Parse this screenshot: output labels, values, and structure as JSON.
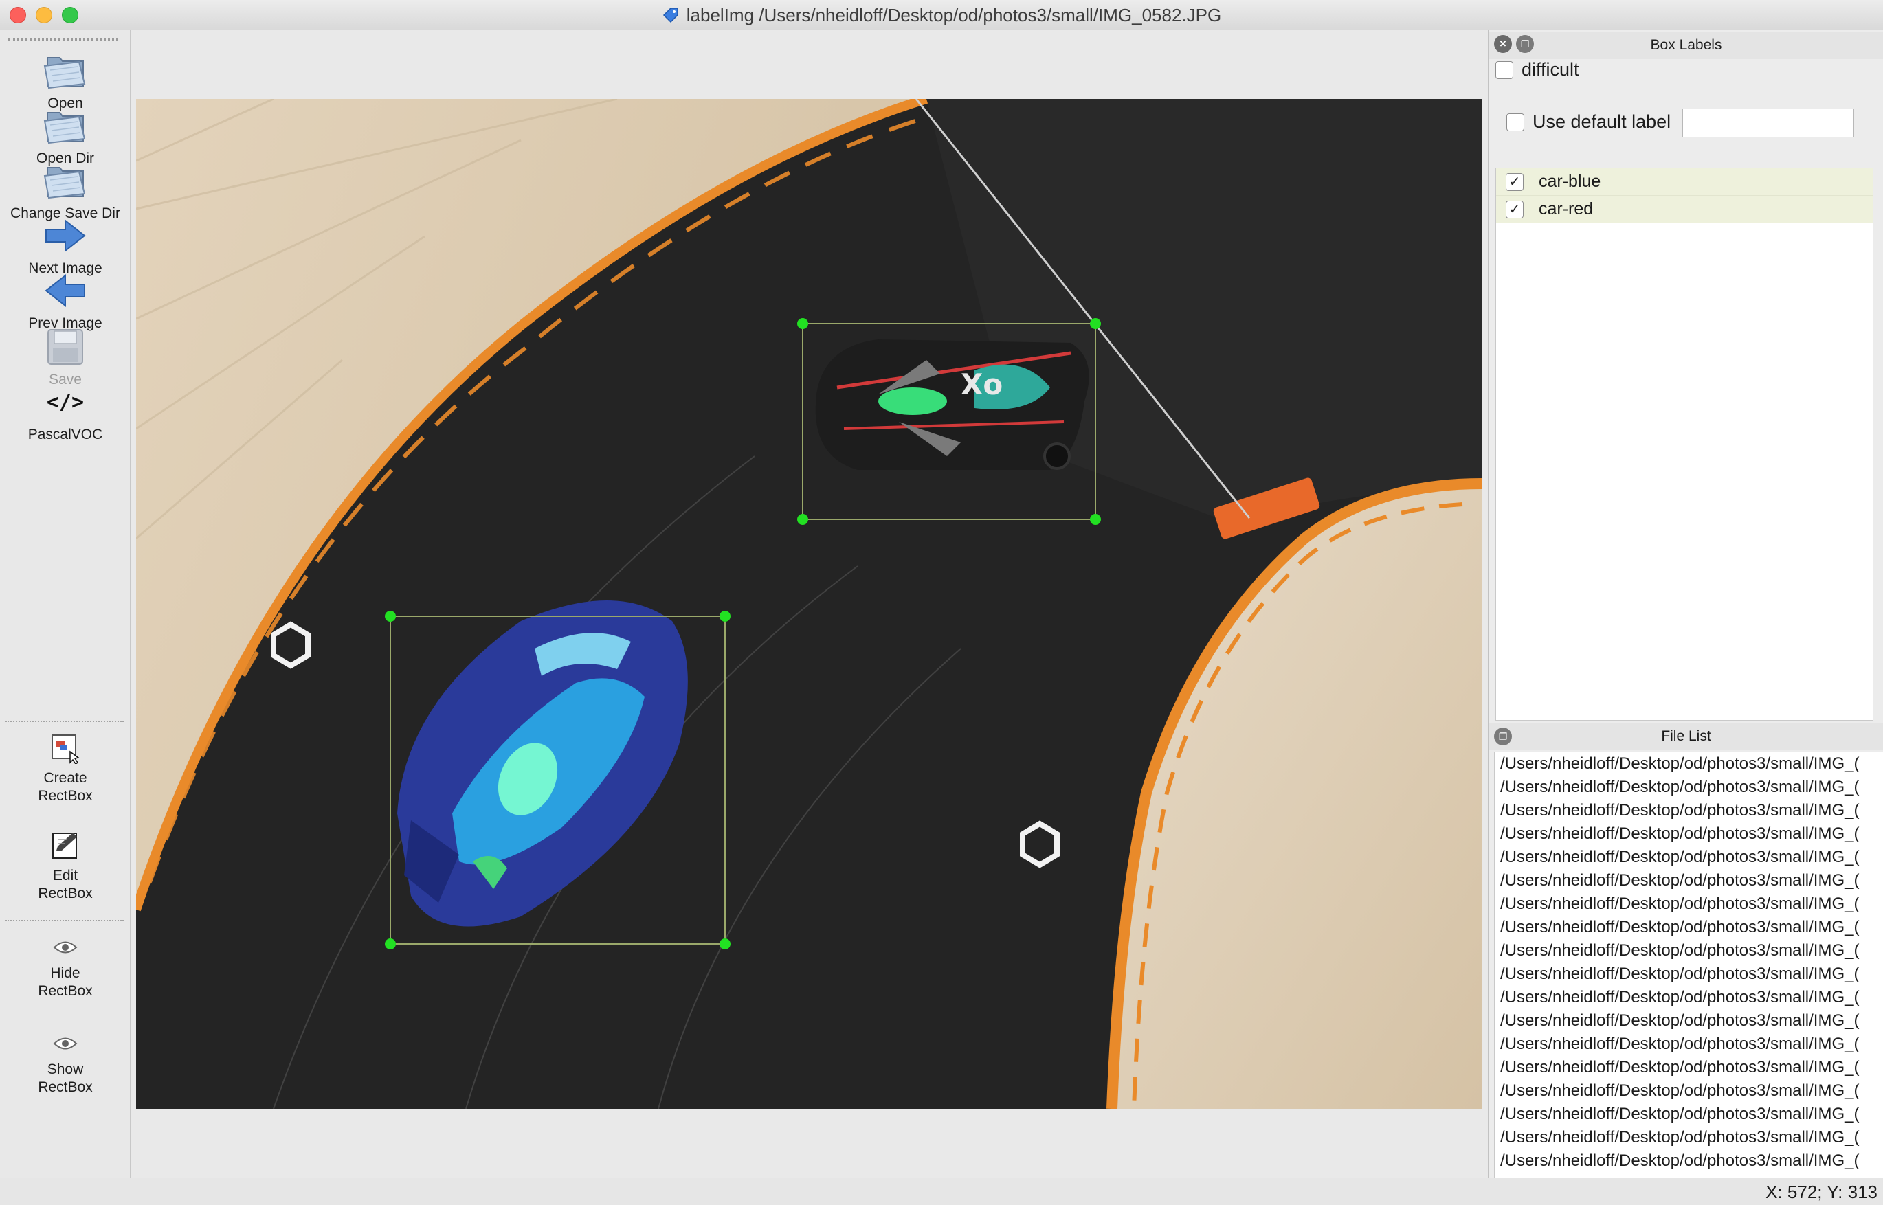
{
  "window": {
    "title": "labelImg /Users/nheidloff/Desktop/od/photos3/small/IMG_0582.JPG"
  },
  "toolbar": {
    "items": [
      {
        "label": "Open",
        "icon": "folder-open-icon",
        "enabled": true
      },
      {
        "label": "Open Dir",
        "icon": "folder-open-icon",
        "enabled": true
      },
      {
        "label": "Change Save Dir",
        "icon": "folder-open-icon",
        "enabled": true
      },
      {
        "label": "Next Image",
        "icon": "arrow-right-icon",
        "enabled": true
      },
      {
        "label": "Prev Image",
        "icon": "arrow-left-icon",
        "enabled": true
      },
      {
        "label": "Save",
        "icon": "floppy-disk-icon",
        "enabled": false
      },
      {
        "label": "PascalVOC",
        "icon": "code-brackets-icon",
        "enabled": true
      },
      {
        "label": "Create\nRectBox",
        "icon": "create-rectbox-icon",
        "enabled": true
      },
      {
        "label": "Edit\nRectBox",
        "icon": "edit-rectbox-icon",
        "enabled": true
      },
      {
        "label": "Hide\nRectBox",
        "icon": "eye-icon",
        "enabled": true
      },
      {
        "label": "Show\nRectBox",
        "icon": "eye-icon",
        "enabled": true
      }
    ]
  },
  "box_labels_panel": {
    "title": "Box Labels",
    "difficult_label": "difficult",
    "difficult_checked": false,
    "use_default_label": "Use default label",
    "use_default_checked": false,
    "default_label_value": "",
    "labels": [
      {
        "name": "car-blue",
        "checked": true
      },
      {
        "name": "car-red",
        "checked": true
      }
    ]
  },
  "file_list_panel": {
    "title": "File List",
    "files": [
      "/Users/nheidloff/Desktop/od/photos3/small/IMG_(",
      "/Users/nheidloff/Desktop/od/photos3/small/IMG_(",
      "/Users/nheidloff/Desktop/od/photos3/small/IMG_(",
      "/Users/nheidloff/Desktop/od/photos3/small/IMG_(",
      "/Users/nheidloff/Desktop/od/photos3/small/IMG_(",
      "/Users/nheidloff/Desktop/od/photos3/small/IMG_(",
      "/Users/nheidloff/Desktop/od/photos3/small/IMG_(",
      "/Users/nheidloff/Desktop/od/photos3/small/IMG_(",
      "/Users/nheidloff/Desktop/od/photos3/small/IMG_(",
      "/Users/nheidloff/Desktop/od/photos3/small/IMG_(",
      "/Users/nheidloff/Desktop/od/photos3/small/IMG_(",
      "/Users/nheidloff/Desktop/od/photos3/small/IMG_(",
      "/Users/nheidloff/Desktop/od/photos3/small/IMG_(",
      "/Users/nheidloff/Desktop/od/photos3/small/IMG_(",
      "/Users/nheidloff/Desktop/od/photos3/small/IMG_(",
      "/Users/nheidloff/Desktop/od/photos3/small/IMG_(",
      "/Users/nheidloff/Desktop/od/photos3/small/IMG_(",
      "/Users/nheidloff/Desktop/od/photos3/small/IMG_("
    ]
  },
  "status": {
    "coords": "X: 572; Y: 313"
  },
  "colors": {
    "bbox_line": "#9aa86a",
    "bbox_handle": "#22e022",
    "list_selected_bg": "#eef1dc"
  }
}
